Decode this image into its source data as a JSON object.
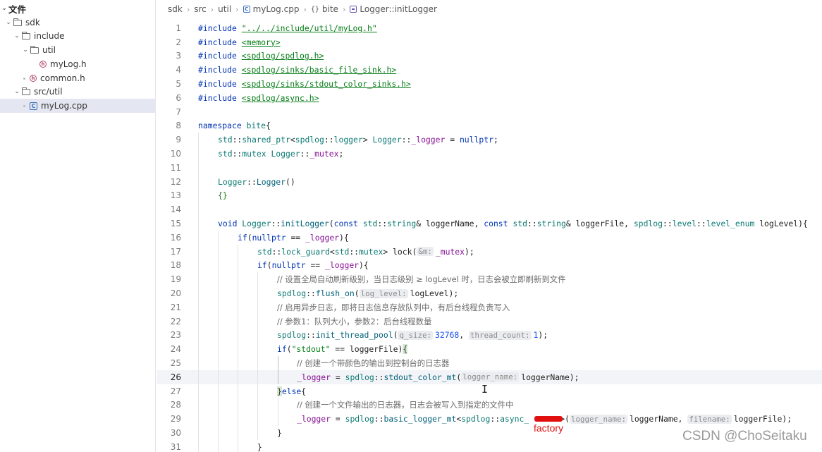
{
  "sidebar": {
    "header": "文件",
    "items": [
      {
        "label": "sdk",
        "type": "folder",
        "expanded": true
      },
      {
        "label": "include",
        "type": "folder",
        "expanded": true
      },
      {
        "label": "util",
        "type": "folder",
        "expanded": true
      },
      {
        "label": "myLog.h",
        "type": "header-file"
      },
      {
        "label": "common.h",
        "type": "header-file"
      },
      {
        "label": "src/util",
        "type": "folder",
        "expanded": true
      },
      {
        "label": "myLog.cpp",
        "type": "cpp-file",
        "selected": true
      }
    ]
  },
  "breadcrumb": {
    "parts": [
      "sdk",
      "src",
      "util",
      "myLog.cpp",
      "bite",
      "Logger::initLogger"
    ],
    "namespace_icon": "{}"
  },
  "editor": {
    "current_line": 26,
    "lines": [
      {
        "n": "1"
      },
      {
        "n": "2"
      },
      {
        "n": "3"
      },
      {
        "n": "4"
      },
      {
        "n": "5"
      },
      {
        "n": "6"
      },
      {
        "n": "7"
      },
      {
        "n": "8"
      },
      {
        "n": "9"
      },
      {
        "n": "10"
      },
      {
        "n": "11"
      },
      {
        "n": "12"
      },
      {
        "n": "13"
      },
      {
        "n": "14"
      },
      {
        "n": "15"
      },
      {
        "n": "16"
      },
      {
        "n": "17"
      },
      {
        "n": "18"
      },
      {
        "n": "19"
      },
      {
        "n": "20"
      },
      {
        "n": "21"
      },
      {
        "n": "22"
      },
      {
        "n": "23"
      },
      {
        "n": "24"
      },
      {
        "n": "25"
      },
      {
        "n": "26"
      },
      {
        "n": "27"
      },
      {
        "n": "28"
      },
      {
        "n": "29"
      },
      {
        "n": "30"
      },
      {
        "n": "31"
      }
    ],
    "t": {
      "include": "#include",
      "inc1": "\"../../include/util/myLog.h\"",
      "inc2": "<memory>",
      "inc3": "<spdlog/spdlog.h>",
      "inc4": "<spdlog/sinks/basic_file_sink.h>",
      "inc5": "<spdlog/sinks/stdout_color_sinks.h>",
      "inc6": "<spdlog/async.h>",
      "namespace": "namespace",
      "bite": "bite",
      "std": "std",
      "spdlog": "spdlog",
      "shared_ptr": "shared_ptr",
      "logger": "logger",
      "Logger": "Logger",
      "_logger": "_logger",
      "nullptr": "nullptr",
      "mutex": "mutex",
      "_mutex": "_mutex",
      "void": "void",
      "initLogger": "initLogger",
      "const": "const",
      "string": "string",
      "loggerName": "loggerName",
      "loggerFile": "loggerFile",
      "level": "level",
      "level_enum": "level_enum",
      "logLevel": "logLevel",
      "if": "if",
      "lock_guard": "lock_guard",
      "lock": "lock",
      "hint_m": "&m:",
      "cm19": "// 设置全局自动刷新级别，当日志级别 ≥ logLevel 时，日志会被立即刷新到文件",
      "flush_on": "flush_on",
      "hint_log_level": "log_level:",
      "cm21": "// 启用异步日志，即将日志信息存放队列中，有后台线程负责写入",
      "cm22": "// 参数1：队列大小，参数2：后台线程数量",
      "init_thread_pool": "init_thread_pool",
      "hint_q_size": "q_size:",
      "q_size_val": "32768",
      "hint_thread_count": "thread_count:",
      "thread_count_val": "1",
      "stdout_str": "\"stdout\"",
      "cm25": "// 创建一个带颜色的输出到控制台的日志器",
      "stdout_color_mt": "stdout_color_mt",
      "hint_logger_name": "logger_name:",
      "else": "else",
      "cm28": "// 创建一个文件输出的日志器，日志会被写入到指定的文件中",
      "basic_logger_mt": "basic_logger_mt",
      "async_": "async_",
      "hint_filename": "filename:"
    }
  },
  "overlays": {
    "annotation": "factory",
    "watermark": "CSDN @ChoSeitaku"
  },
  "colors": {
    "keyword": "#0033b3",
    "namespace_type": "#0d7a74",
    "function": "#00627a",
    "member": "#871094",
    "string": "#067d17",
    "number": "#1750eb",
    "comment": "#6b6b6b",
    "annotation_red": "#e01010",
    "selection": "#e4e6f1"
  }
}
